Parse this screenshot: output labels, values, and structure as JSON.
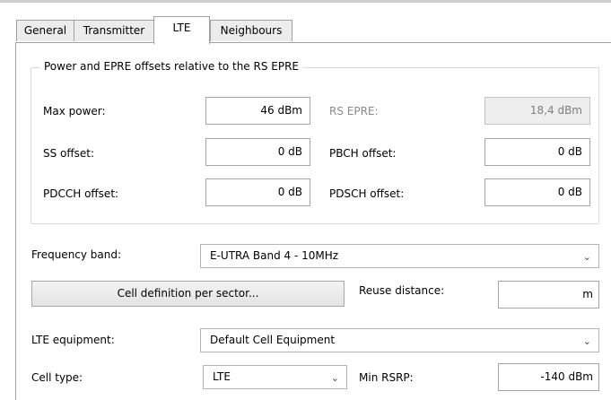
{
  "tabs": [
    {
      "label": "General"
    },
    {
      "label": "Transmitter"
    },
    {
      "label": "LTE"
    },
    {
      "label": "Neighbours"
    }
  ],
  "active_tab": "LTE",
  "power_group": {
    "title": "Power and EPRE offsets relative to the RS EPRE",
    "max_power": {
      "label": "Max power:",
      "value": "46 dBm"
    },
    "rs_epre": {
      "label": "RS EPRE:",
      "value": "18,4 dBm"
    },
    "ss_offset": {
      "label": "SS offset:",
      "value": "0 dB"
    },
    "pbch_offset": {
      "label": "PBCH offset:",
      "value": "0 dB"
    },
    "pdcch_offset": {
      "label": "PDCCH offset:",
      "value": "0 dB"
    },
    "pdsch_offset": {
      "label": "PDSCH offset:",
      "value": "0 dB"
    }
  },
  "frequency_band": {
    "label": "Frequency band:",
    "value": "E-UTRA Band 4 - 10MHz"
  },
  "cell_definition_button": "Cell definition per sector...",
  "reuse_distance": {
    "label": "Reuse distance:",
    "value": "m"
  },
  "lte_equipment": {
    "label": "LTE equipment:",
    "value": "Default Cell Equipment"
  },
  "cell_type": {
    "label": "Cell type:",
    "value": "LTE"
  },
  "min_rsrp": {
    "label": "Min RSRP:",
    "value": "-140 dBm"
  },
  "icons": {
    "dropdown": "chevron-down-icon"
  }
}
